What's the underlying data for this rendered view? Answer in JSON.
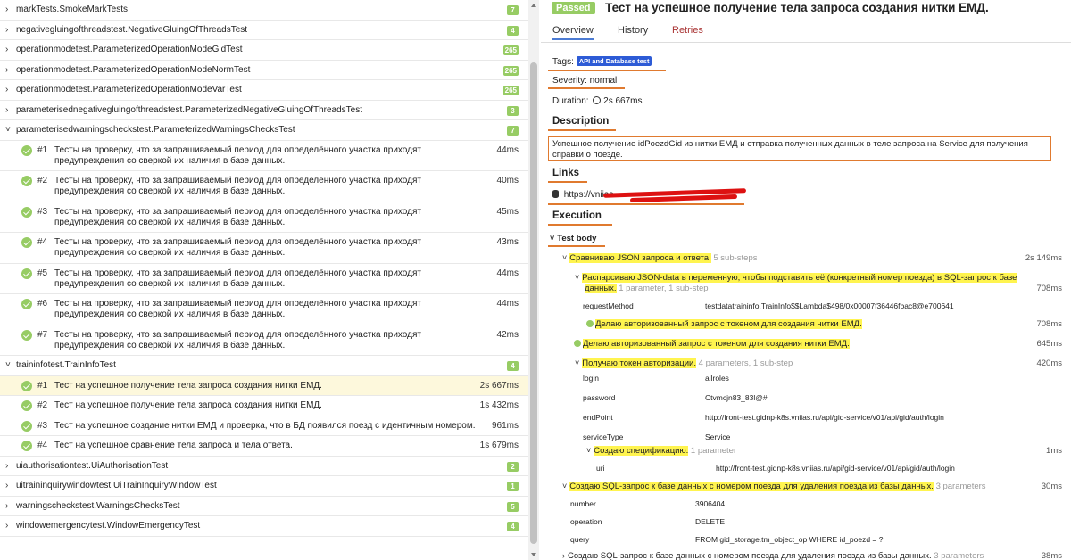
{
  "tree": {
    "groups_top": [
      {
        "name": "markTests.SmokeMarkTests",
        "count": "7"
      },
      {
        "name": "negativegluingofthreadstest.NegativeGluingOfThreadsTest",
        "count": "4"
      },
      {
        "name": "operationmodetest.ParameterizedOperationModeGidTest",
        "count": "265"
      },
      {
        "name": "operationmodetest.ParameterizedOperationModeNormTest",
        "count": "265"
      },
      {
        "name": "operationmodetest.ParameterizedOperationModeVarTest",
        "count": "265"
      },
      {
        "name": "parameterisednegativegluingofthreadstest.ParameterizedNegativeGluingOfThreadsTest",
        "count": "3"
      },
      {
        "name": "parameterisedwarningscheckstest.ParameterizedWarningsChecksTest",
        "count": "7"
      }
    ],
    "warning_tests": [
      {
        "num": "#1",
        "name": "Тесты на проверку, что за запрашиваемый период для определённого участка приходят предупреждения со сверкой их наличия в базе данных.",
        "dur": "44ms"
      },
      {
        "num": "#2",
        "name": "Тесты на проверку, что за запрашиваемый период для определённого участка приходят предупреждения со сверкой их наличия в базе данных.",
        "dur": "40ms"
      },
      {
        "num": "#3",
        "name": "Тесты на проверку, что за запрашиваемый период для определённого участка приходят предупреждения со сверкой их наличия в базе данных.",
        "dur": "45ms"
      },
      {
        "num": "#4",
        "name": "Тесты на проверку, что за запрашиваемый период для определённого участка приходят предупреждения со сверкой их наличия в базе данных.",
        "dur": "43ms"
      },
      {
        "num": "#5",
        "name": "Тесты на проверку, что за запрашиваемый период для определённого участка приходят предупреждения со сверкой их наличия в базе данных.",
        "dur": "44ms"
      },
      {
        "num": "#6",
        "name": "Тесты на проверку, что за запрашиваемый период для определённого участка приходят предупреждения со сверкой их наличия в базе данных.",
        "dur": "44ms"
      },
      {
        "num": "#7",
        "name": "Тесты на проверку, что за запрашиваемый период для определённого участка приходят предупреждения со сверкой их наличия в базе данных.",
        "dur": "42ms"
      }
    ],
    "traininfo_group": {
      "name": "traininfotest.TrainInfoTest",
      "count": "4"
    },
    "traininfo_tests": [
      {
        "num": "#1",
        "name": "Тест на успешное получение тела запроса создания нитки ЕМД.",
        "dur": "2s 667ms"
      },
      {
        "num": "#2",
        "name": "Тест на успешное получение тела запроса создания нитки ЕМД.",
        "dur": "1s 432ms"
      },
      {
        "num": "#3",
        "name": "Тест на успешное создание нитки ЕМД и проверка, что в БД появился поезд с идентичным номером.",
        "dur": "961ms"
      },
      {
        "num": "#4",
        "name": "Тест на успешное сравнение тела запроса и тела ответа.",
        "dur": "1s 679ms"
      }
    ],
    "groups_bottom": [
      {
        "name": "uiauthorisationtest.UiAuthorisationTest",
        "count": "2"
      },
      {
        "name": "uitraininquirywindowtest.UiTrainInquiryWindowTest",
        "count": "1"
      },
      {
        "name": "warningscheckstest.WarningsChecksTest",
        "count": "5"
      },
      {
        "name": "windowemergencytest.WindowEmergencyTest",
        "count": "4"
      }
    ]
  },
  "detail": {
    "status": "Passed",
    "title": "Тест на успешное получение тела запроса создания нитки ЕМД.",
    "tabs": [
      "Overview",
      "History",
      "Retries"
    ],
    "tags_label": "Tags:",
    "tag": "API and Database test",
    "severity": "Severity: normal",
    "duration_label": "Duration:",
    "duration_value": "2s 667ms",
    "description_heading": "Description",
    "description": "Успешное получение idPoezdGid из нитки ЕМД и отправка полученных данных в теле запроса на Service для получения справки о поезде.",
    "links_heading": "Links",
    "link": "https://vniias.",
    "execution_heading": "Execution",
    "test_body": "Test body",
    "steps": {
      "s1": {
        "label": "Сравниваю JSON запроса и ответа.",
        "meta": "5 sub-steps",
        "dur": "2s 149ms"
      },
      "s1a": {
        "label": "Распарсиваю JSON-data в переменную, чтобы подставить её (конкретный номер поезда) в SQL-запрос к базе",
        "label2": "данных.",
        "meta": "1 parameter, 1 sub-step",
        "dur": "708ms"
      },
      "s1a_param": {
        "key": "requestMethod",
        "value": "testdatatraininfo.TrainInfo$$Lambda$498/0x00007f36446fbac8@e700641"
      },
      "s1a_sub": {
        "label": "Делаю авторизованный запрос с токеном для создания нитки ЕМД.",
        "dur": "708ms"
      },
      "s1b": {
        "label": "Делаю авторизованный запрос с токеном для создания нитки ЕМД.",
        "dur": "645ms"
      },
      "s1c": {
        "label": "Получаю токен авторизации.",
        "meta": "4 parameters, 1 sub-step",
        "dur": "420ms"
      },
      "s1c_params": [
        {
          "key": "login",
          "value": "allroles"
        },
        {
          "key": "password",
          "value": "Ctvmcjn83_83l@#"
        },
        {
          "key": "endPoint",
          "value": "http://front-test.gidnp-k8s.vniias.ru/api/gid-service/v01/api/gid/auth/login"
        },
        {
          "key": "serviceType",
          "value": "Service"
        }
      ],
      "s1d": {
        "label": "Создаю спецификацию.",
        "meta": "1 parameter",
        "dur": "1ms"
      },
      "s1d_param": {
        "key": "uri",
        "value": "http://front-test.gidnp-k8s.vniias.ru/api/gid-service/v01/api/gid/auth/login"
      },
      "s2": {
        "label": "Создаю SQL-запрос к базе данных с номером поезда для удаления поезда из базы данных.",
        "meta": "3 parameters",
        "dur": "30ms"
      },
      "s2_params": [
        {
          "key": "number",
          "value": "3906404"
        },
        {
          "key": "operation",
          "value": "DELETE"
        },
        {
          "key": "query",
          "value": "FROM gid_storage.tm_object_op WHERE id_poezd = ?"
        }
      ],
      "s3": {
        "label": "Создаю SQL-запрос к базе данных с номером поезда для удаления поезда из базы данных.",
        "meta": "3 parameters",
        "dur": "38ms"
      }
    }
  },
  "colors": {
    "passed": "#97cc64",
    "tag": "#2d5bd6",
    "highlight": "#fff44f",
    "annotation": "#e07a2f",
    "retries": "#a83232"
  }
}
